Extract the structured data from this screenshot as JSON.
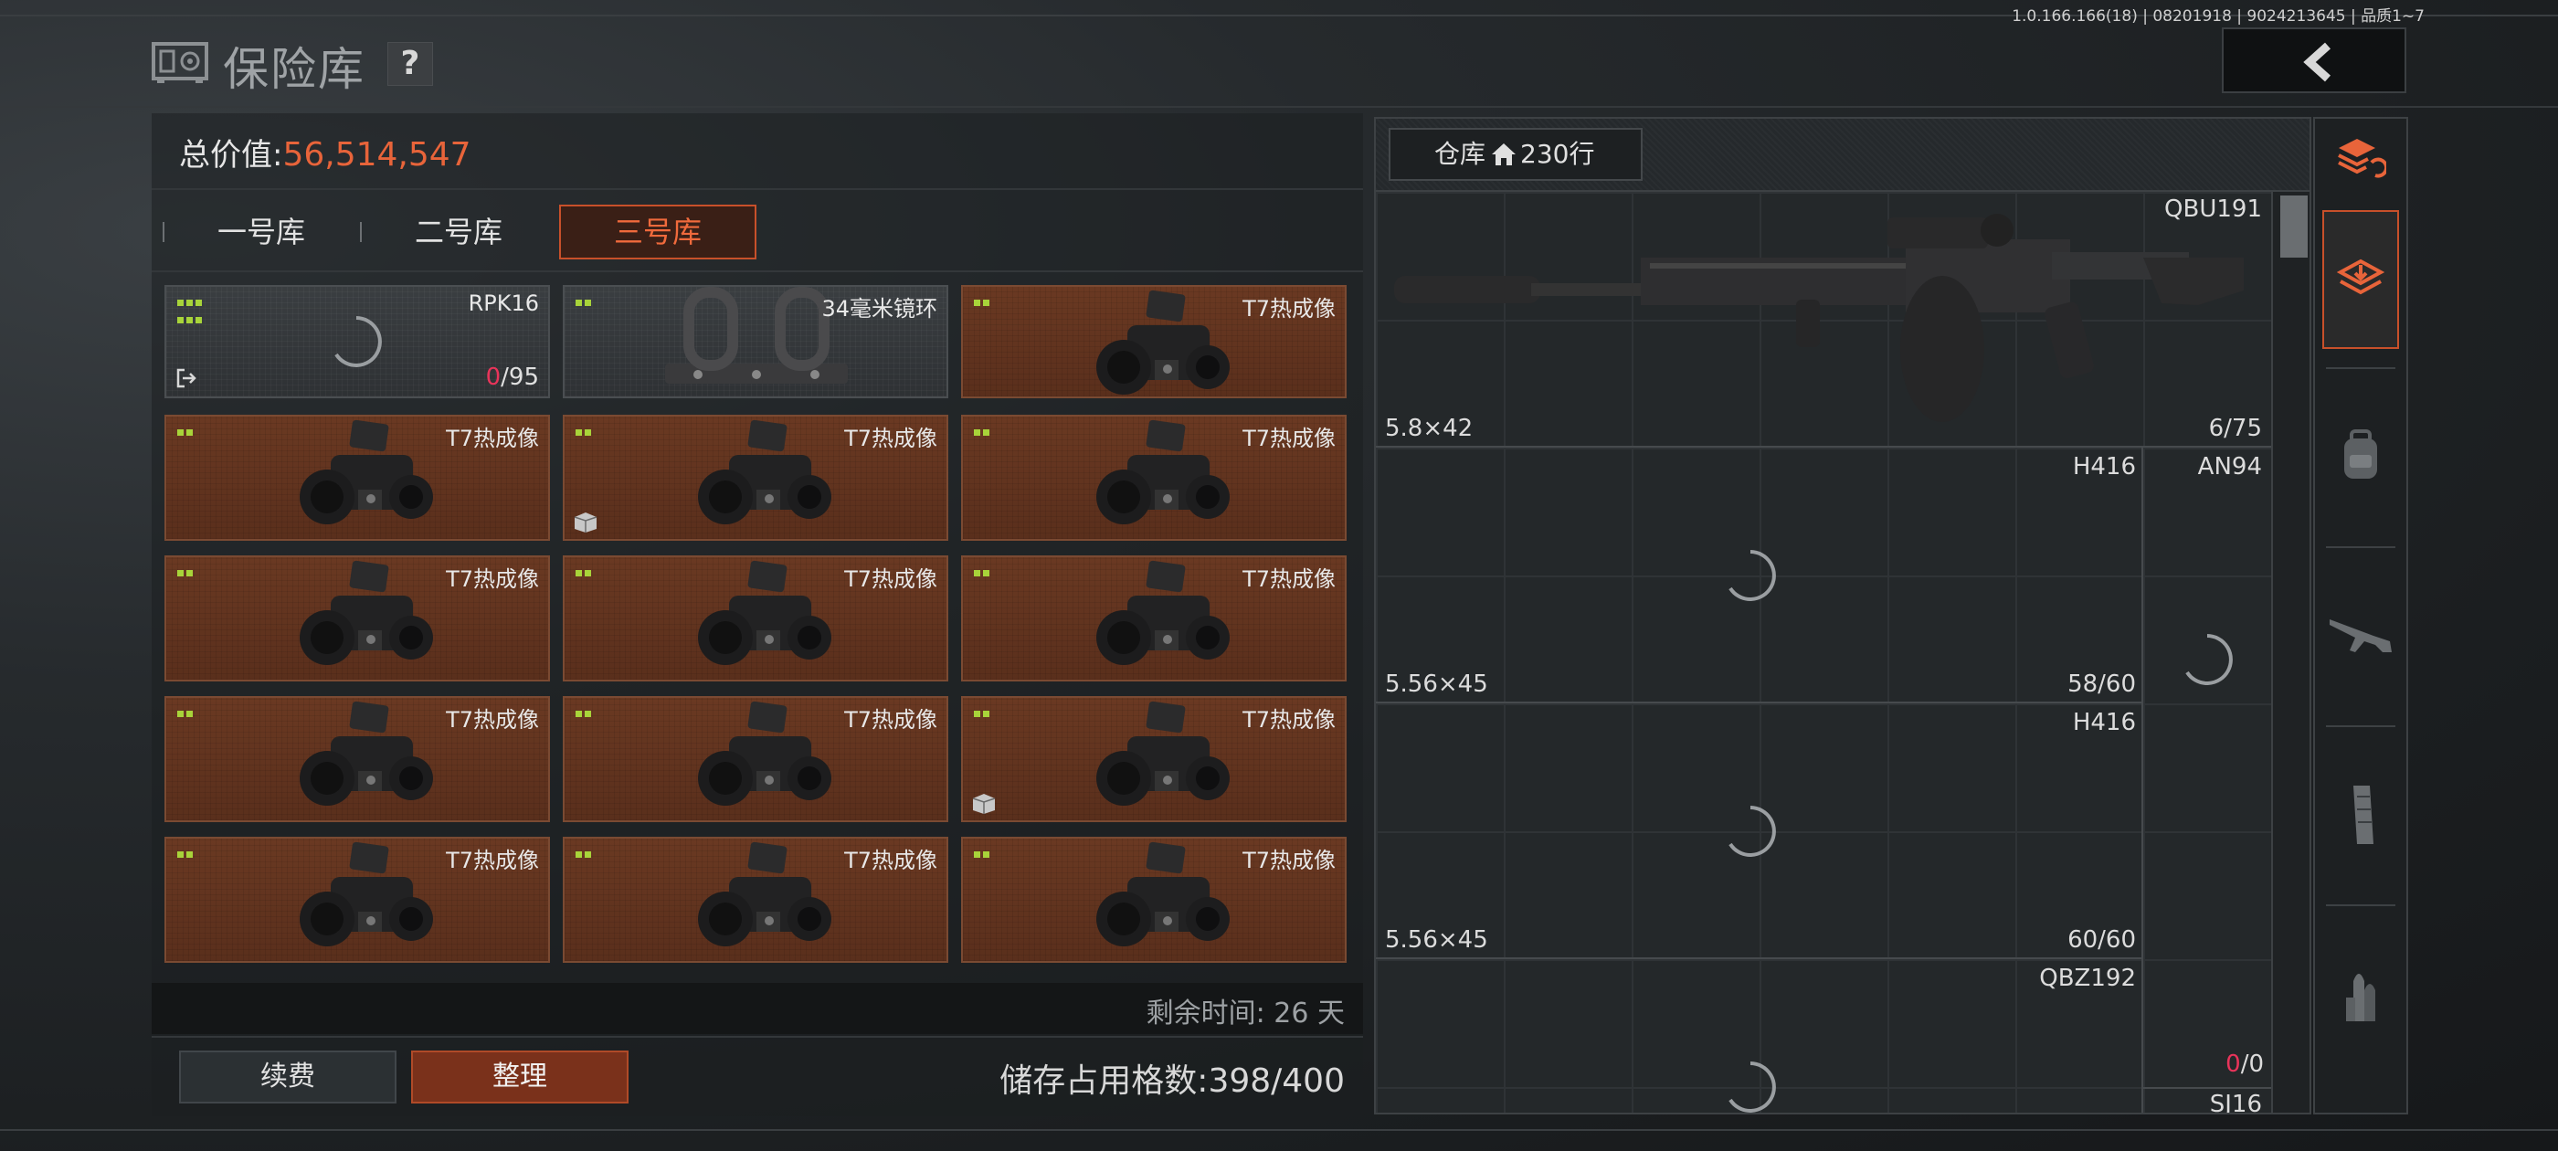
{
  "version_text": "1.0.166.166(18) | 08201918 | 9024213645 | 品质1~7",
  "header": {
    "title": "保险库",
    "help_label": "?",
    "back_icon": "chevron-left-icon"
  },
  "summary": {
    "total_label": "总价值:",
    "total_value": "56,514,547"
  },
  "tabs": [
    {
      "label": "一号库",
      "active": false
    },
    {
      "label": "二号库",
      "active": false
    },
    {
      "label": "三号库",
      "active": true
    }
  ],
  "vault_items": [
    {
      "name": "RPK16",
      "style": "grey",
      "kind": "spinner",
      "count_red": "0",
      "count_rest": "/95",
      "exit_icon": true,
      "dots": 6
    },
    {
      "name": "34毫米镜环",
      "style": "grey",
      "kind": "ring",
      "dots": 2
    },
    {
      "name": "T7热成像",
      "style": "orange",
      "kind": "thermal",
      "dots": 2
    },
    {
      "name": "T7热成像",
      "style": "orange",
      "kind": "thermal",
      "dots": 2
    },
    {
      "name": "T7热成像",
      "style": "orange",
      "kind": "thermal",
      "dots": 2,
      "box_icon": true
    },
    {
      "name": "T7热成像",
      "style": "orange",
      "kind": "thermal",
      "dots": 2
    },
    {
      "name": "T7热成像",
      "style": "orange",
      "kind": "thermal",
      "dots": 2
    },
    {
      "name": "T7热成像",
      "style": "orange",
      "kind": "thermal",
      "dots": 2
    },
    {
      "name": "T7热成像",
      "style": "orange",
      "kind": "thermal",
      "dots": 2
    },
    {
      "name": "T7热成像",
      "style": "orange",
      "kind": "thermal",
      "dots": 2
    },
    {
      "name": "T7热成像",
      "style": "orange",
      "kind": "thermal",
      "dots": 2
    },
    {
      "name": "T7热成像",
      "style": "orange",
      "kind": "thermal",
      "dots": 2,
      "box_icon": true
    },
    {
      "name": "T7热成像",
      "style": "orange",
      "kind": "thermal",
      "dots": 2
    },
    {
      "name": "T7热成像",
      "style": "orange",
      "kind": "thermal",
      "dots": 2
    },
    {
      "name": "T7热成像",
      "style": "orange",
      "kind": "thermal",
      "dots": 2
    }
  ],
  "footer": {
    "remaining_label": "剩余时间:",
    "remaining_value": "26 天",
    "renew_label": "续费",
    "sort_label": "整理",
    "storage_label": "储存占用格数:",
    "storage_value": "398/400"
  },
  "warehouse": {
    "button_label": "仓库",
    "rows_label": "230行",
    "slots": [
      {
        "name": "QBU191",
        "ammo": "5.8×42",
        "count": "6/75"
      },
      {
        "name": "H416",
        "ammo": "5.56×45",
        "count": "58/60",
        "side_name": "AN94"
      },
      {
        "name": "H416",
        "ammo": "5.56×45",
        "count": "60/60"
      },
      {
        "name": "QBZ192",
        "count_red": "0",
        "count_rest": "/0",
        "side_name": "SJ16"
      }
    ]
  },
  "sidebar_icons": [
    "layers-refresh-icon",
    "layers-download-icon",
    "backpack-icon",
    "rifle-icon",
    "magazine-icon",
    "ammo-icon"
  ],
  "colors": {
    "accent": "#e8643a",
    "accent_border": "#c8502a",
    "rarity_dot": "#a8d43a",
    "item_bg_orange": "#5a2f1c",
    "count_red": "#e8345a"
  }
}
